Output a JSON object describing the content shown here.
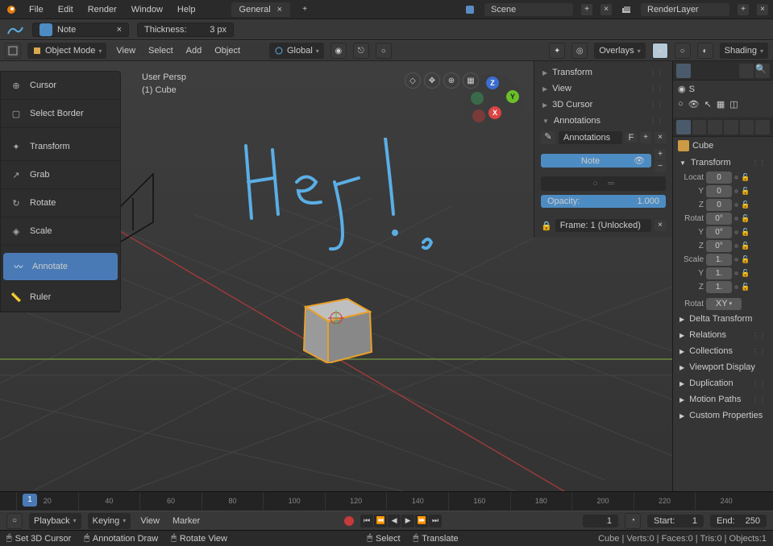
{
  "topmenu": {
    "file": "File",
    "edit": "Edit",
    "render": "Render",
    "window": "Window",
    "help": "Help"
  },
  "workspace_tab": "General",
  "scene_field": "Scene",
  "renderlayer_field": "RenderLayer",
  "annot_tool": {
    "layer_name": "Note",
    "thickness_label": "Thickness:",
    "thickness_value": "3 px"
  },
  "header": {
    "mode": "Object Mode",
    "view": "View",
    "select": "Select",
    "add": "Add",
    "object": "Object",
    "orientation": "Global",
    "overlays": "Overlays",
    "shading": "Shading"
  },
  "toolbar": {
    "cursor": "Cursor",
    "select_border": "Select Border",
    "transform": "Transform",
    "grab": "Grab",
    "rotate": "Rotate",
    "scale": "Scale",
    "annotate": "Annotate",
    "ruler": "Ruler"
  },
  "viewport_info": {
    "persp": "User Persp",
    "active": "(1) Cube"
  },
  "npanel": {
    "transform": "Transform",
    "view": "View",
    "cursor3d": "3D Cursor",
    "annotations": "Annotations",
    "annotations_block": "Annotations",
    "f_btn": "F",
    "note": "Note",
    "opacity_label": "Opacity:",
    "opacity_value": "1.000",
    "frame_lock": "Frame: 1 (Unlocked)"
  },
  "properties": {
    "object_name": "Cube",
    "transform_header": "Transform",
    "locat": "Locat",
    "rotat": "Rotat",
    "scale": "Scale",
    "y": "Y",
    "z": "Z",
    "loc_x": "0",
    "loc_y": "0",
    "loc_z": "0",
    "rot_x": "0°",
    "rot_y": "0°",
    "rot_z": "0°",
    "scale_x": "1.",
    "scale_y": "1.",
    "scale_z": "1.",
    "rotmode_label": "Rotat",
    "rotmode": "XY",
    "deltatf": "Delta Transform",
    "relations": "Relations",
    "collections": "Collections",
    "viewport_display": "Viewport Display",
    "duplication": "Duplication",
    "motion_paths": "Motion Paths",
    "custom_props": "Custom Properties"
  },
  "outliner": {
    "s": "S"
  },
  "timeline": {
    "ticks": [
      "20",
      "40",
      "60",
      "80",
      "100",
      "120",
      "140",
      "160",
      "180",
      "200",
      "220",
      "240"
    ],
    "current": "1"
  },
  "playbar": {
    "playback": "Playback",
    "keying": "Keying",
    "view": "View",
    "marker": "Marker",
    "frame_cur": "1",
    "start_label": "Start:",
    "start_val": "1",
    "end_label": "End:",
    "end_val": "250"
  },
  "status": {
    "set_cursor": "Set 3D Cursor",
    "annot_draw": "Annotation Draw",
    "rotate_view": "Rotate View",
    "select_action": "Select",
    "translate_action": "Translate",
    "stats": "Cube | Verts:0 | Faces:0 | Tris:0 | Objects:1"
  }
}
